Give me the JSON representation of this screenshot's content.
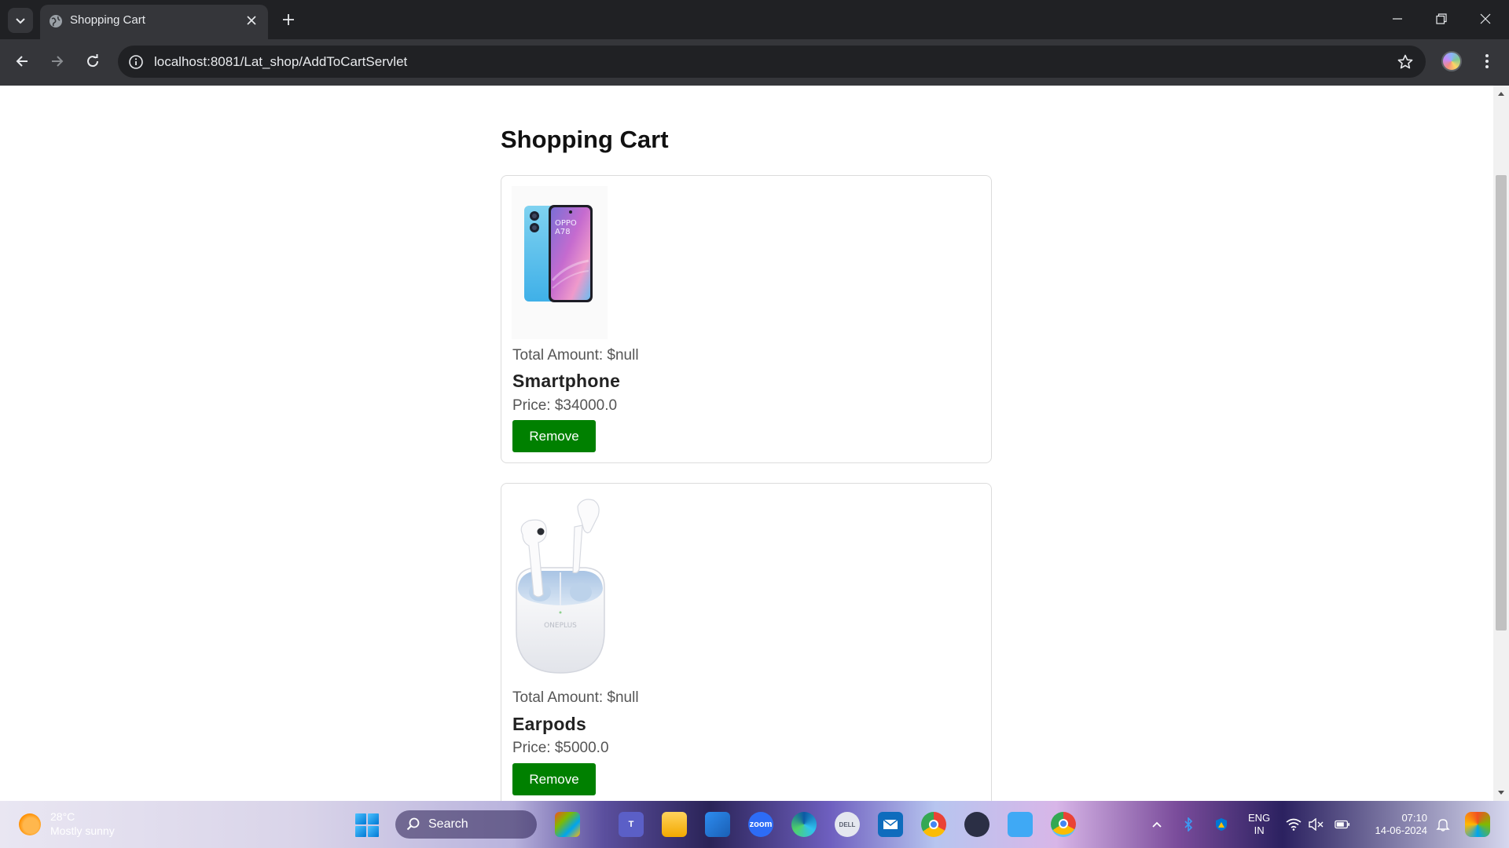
{
  "browser": {
    "tab_title": "Shopping Cart",
    "url": "localhost:8081/Lat_shop/AddToCartServlet"
  },
  "page": {
    "title": "Shopping Cart",
    "items": [
      {
        "image": "oppo-smartphone",
        "total_label": "Total Amount: $null",
        "name": "Smartphone",
        "price_label": "Price: $34000.0",
        "remove_label": "Remove"
      },
      {
        "image": "oneplus-earbuds",
        "total_label": "Total Amount: $null",
        "name": "Earpods",
        "price_label": "Price: $5000.0",
        "remove_label": "Remove"
      }
    ]
  },
  "taskbar": {
    "weather_temp": "28°C",
    "weather_desc": "Mostly sunny",
    "search_label": "Search",
    "apps": [
      "copilot-icon",
      "teams-icon",
      "file-explorer-icon",
      "photos-icon",
      "zoom-icon",
      "edge-icon",
      "dell-icon",
      "mail-icon",
      "chrome-icon",
      "app-icon",
      "notepad-icon",
      "chrome-active-icon"
    ],
    "zoom_label": "zoom",
    "dell_label": "DELL",
    "lang_top": "ENG",
    "lang_bottom": "IN",
    "time": "07:10",
    "date": "14-06-2024"
  },
  "colors": {
    "remove_button": "#008000",
    "chrome_dark": "#202124",
    "chrome_toolbar": "#35363a"
  }
}
